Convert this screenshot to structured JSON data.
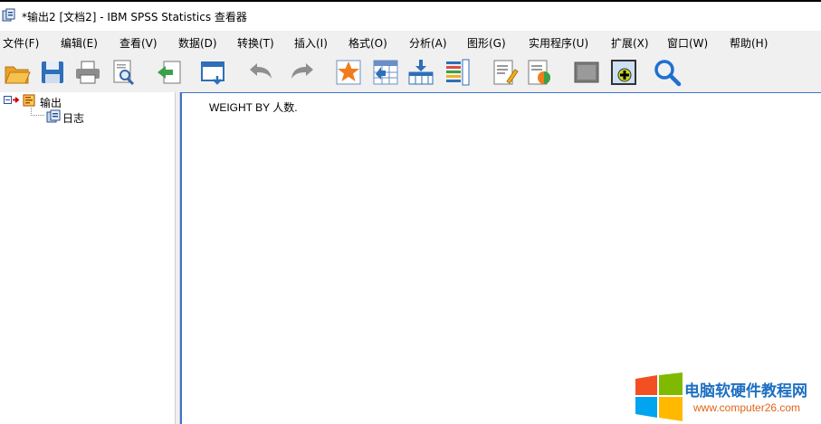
{
  "window": {
    "title": "*输出2 [文档2] - IBM SPSS Statistics 查看器"
  },
  "menubar": {
    "items": [
      "文件(F)",
      "编辑(E)",
      "查看(V)",
      "数据(D)",
      "转换(T)",
      "插入(I)",
      "格式(O)",
      "分析(A)",
      "图形(G)",
      "实用程序(U)",
      "扩展(X)",
      "窗口(W)",
      "帮助(H)"
    ]
  },
  "toolbar": {
    "icons": [
      "open-folder-icon",
      "save-icon",
      "print-icon",
      "print-preview-icon",
      "export-icon",
      "recall-dialog-icon",
      "undo-icon",
      "redo-icon",
      "goto-data-icon",
      "goto-case-icon",
      "goto-variable-icon",
      "variables-icon",
      "designate-window-icon",
      "show-hidden-icon",
      "hide-icon",
      "insert-output-icon",
      "find-icon"
    ]
  },
  "outline": {
    "root_label": "输出",
    "child_label": "日志"
  },
  "content": {
    "log_text": "WEIGHT BY 人数."
  },
  "watermark": {
    "title": "电脑软硬件教程网",
    "url": "www.computer26.com",
    "colors": {
      "red": "#f25022",
      "green": "#7fba00",
      "blue": "#00a4ef",
      "yellow": "#ffb900"
    }
  }
}
